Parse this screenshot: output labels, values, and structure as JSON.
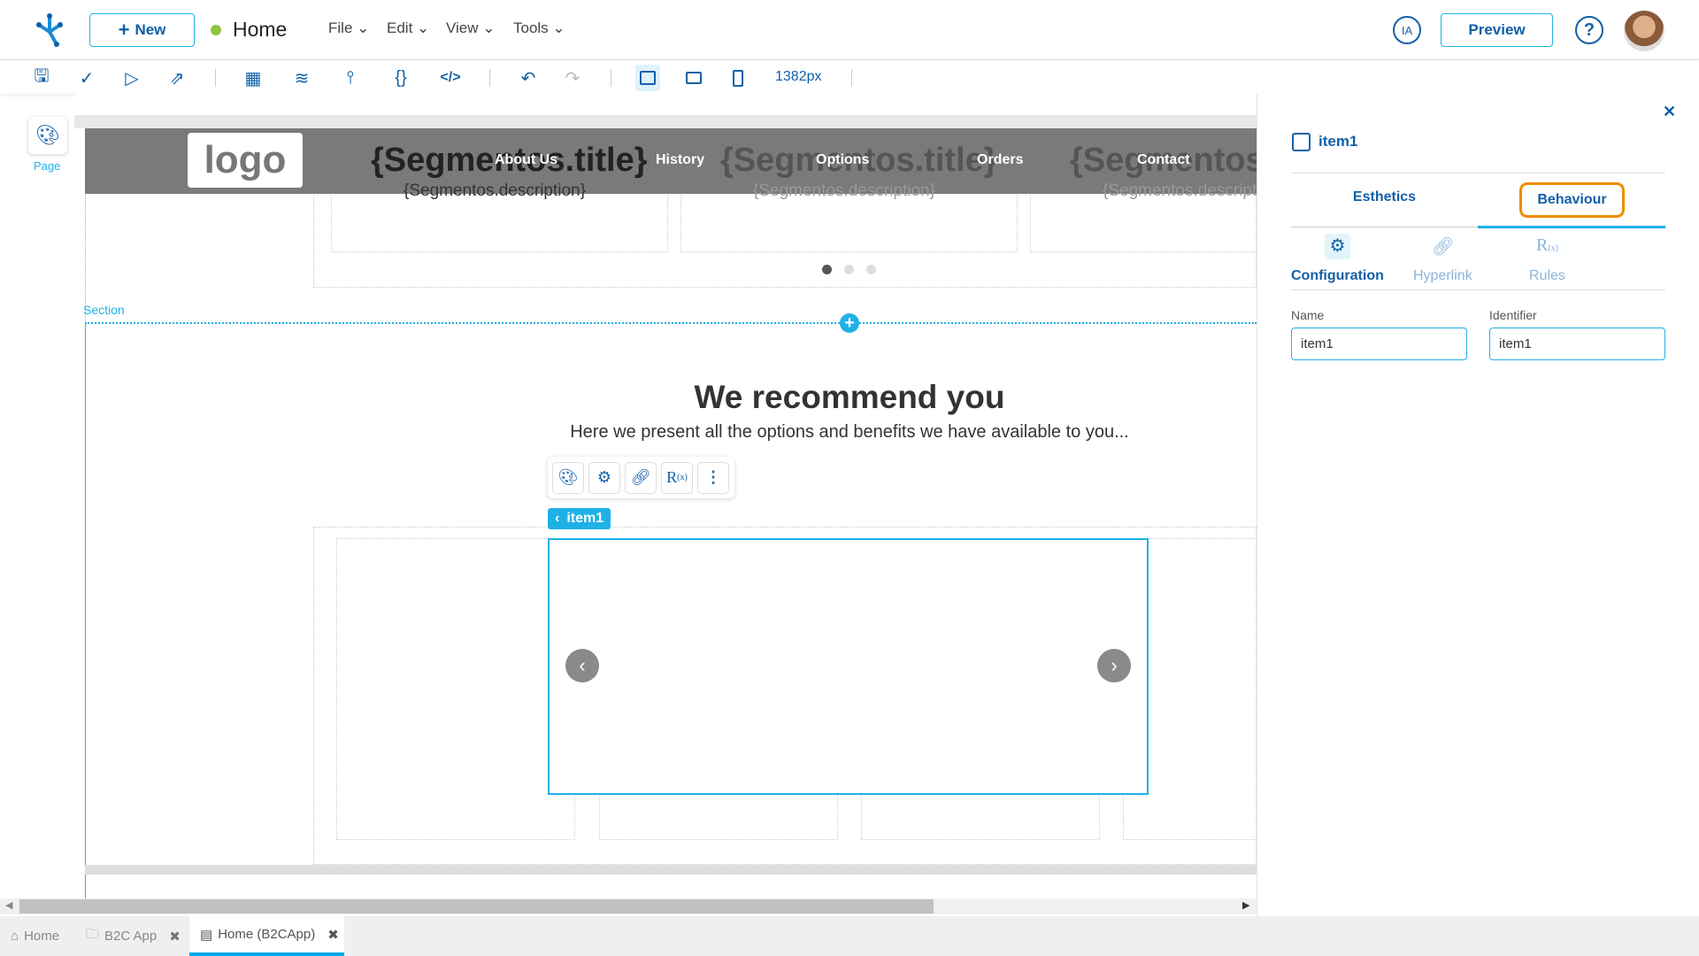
{
  "topbar": {
    "new_label": "New",
    "page_name": "Home",
    "status_color": "#8dc63f",
    "menus": [
      "File",
      "Edit",
      "View",
      "Tools"
    ],
    "ia_label": "IA",
    "preview_label": "Preview"
  },
  "toolbar": {
    "width_label": "1382px"
  },
  "sidebar": {
    "page_label": "Page"
  },
  "canvas": {
    "logo_text": "logo",
    "nav": [
      "About Us",
      "History",
      "Options",
      "Orders",
      "Contact"
    ],
    "segment_title": "{Segmentos.title}",
    "segment_description": "{Segmentos.description}",
    "section_label": "Section",
    "heading": "We recommend you",
    "subheading": "Here we present all the options and benefits we have available to you...",
    "selected_tag": "item1",
    "carousel_active_dot": 1
  },
  "panel": {
    "item_name": "item1",
    "tabs": [
      "Esthetics",
      "Behaviour"
    ],
    "active_tab": "Behaviour",
    "subtabs": [
      "Configuration",
      "Hyperlink",
      "Rules"
    ],
    "name_label": "Name",
    "name_value": "item1",
    "identifier_label": "Identifier",
    "identifier_value": "item1"
  },
  "bottom_tabs": [
    "Home",
    "B2C App",
    "Home (B2CApp)"
  ]
}
